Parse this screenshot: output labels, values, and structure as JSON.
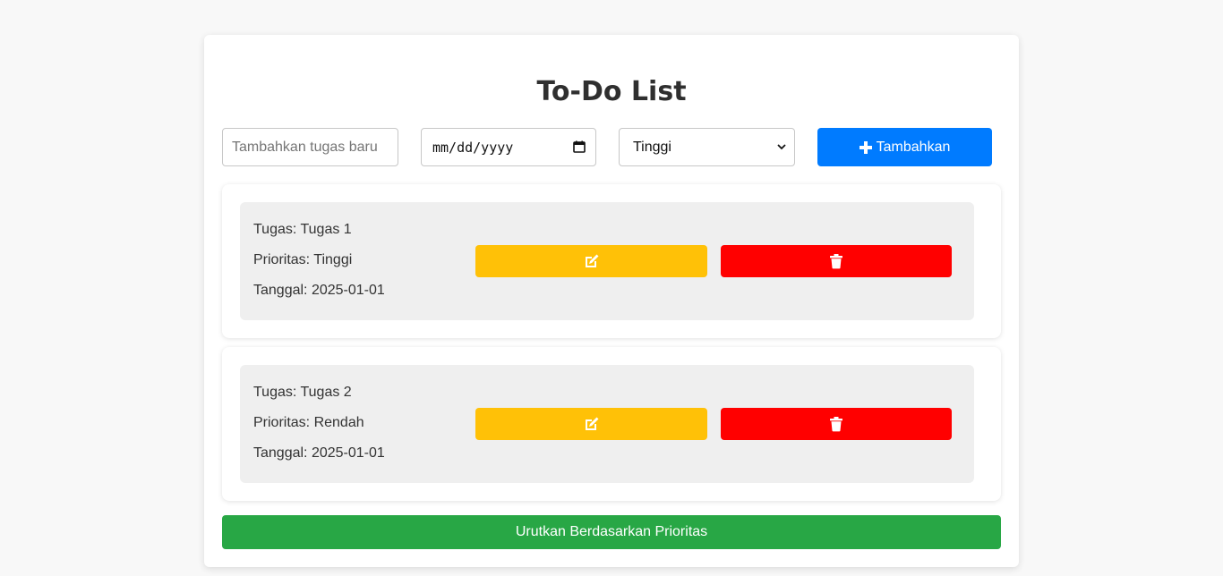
{
  "header": {
    "title": "To-Do List"
  },
  "form": {
    "task_placeholder": "Tambahkan tugas baru",
    "date_placeholder": "mm/dd/yyyy",
    "priority_selected": "Tinggi",
    "add_label": "Tambahkan"
  },
  "tasks": [
    {
      "name": "Tugas: Tugas 1",
      "priority": "Prioritas: Tinggi",
      "date": "Tanggal: 2025-01-01"
    },
    {
      "name": "Tugas: Tugas 2",
      "priority": "Prioritas: Rendah",
      "date": "Tanggal: 2025-01-01"
    }
  ],
  "footer": {
    "sort_label": "Urutkan Berdasarkan Prioritas"
  },
  "icons": {
    "add": "plus-icon",
    "edit": "edit-icon",
    "delete": "trash-icon",
    "date": "calendar-icon",
    "select": "chevron-down-icon"
  },
  "colors": {
    "add_button": "#007bff",
    "edit_button": "#ffc107",
    "delete_button": "#ff0000",
    "sort_button": "#28a745"
  }
}
